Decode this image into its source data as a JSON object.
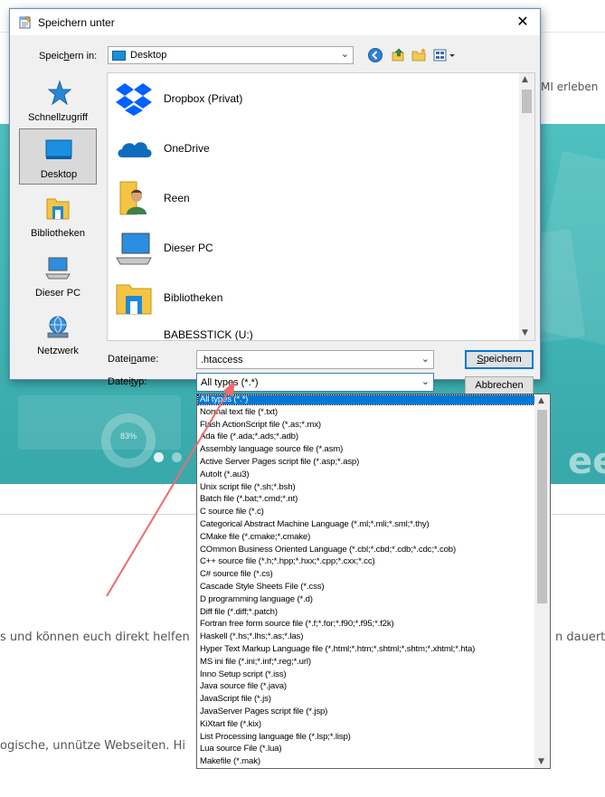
{
  "background_page": {
    "nav_text": "MI erleben",
    "body_text_1": "s und können euch direkt helfen",
    "body_text_2": "n dauert e",
    "body_text_3": "ogische, unnütze Webseiten. Hi",
    "banner_fragment": "ee",
    "banner_badge": "83%"
  },
  "dialog": {
    "title": "Speichern unter",
    "close_symbol": "✕",
    "save_in_label": {
      "pre": "Speic",
      "ul": "h",
      "post": "ern in:"
    },
    "location": "Desktop",
    "places": [
      {
        "label": "Schnellzugriff",
        "icon": "star-icon"
      },
      {
        "label": "Desktop",
        "icon": "desktop-icon",
        "selected": true
      },
      {
        "label": "Bibliotheken",
        "icon": "library-icon"
      },
      {
        "label": "Dieser PC",
        "icon": "computer-icon"
      },
      {
        "label": "Netzwerk",
        "icon": "network-icon"
      }
    ],
    "files": [
      {
        "name": "Dropbox (Privat)",
        "icon": "dropbox-icon"
      },
      {
        "name": "OneDrive",
        "icon": "onedrive-icon"
      },
      {
        "name": "Reen",
        "icon": "user-folder-icon"
      },
      {
        "name": "Dieser PC",
        "icon": "computer-icon"
      },
      {
        "name": "Bibliotheken",
        "icon": "library-icon"
      },
      {
        "name": "BABESSTICK (U:)",
        "icon": "usb-drive-icon"
      }
    ],
    "filename_label": {
      "pre": "Datei",
      "ul": "n",
      "post": "ame:"
    },
    "filename_value": ".htaccess",
    "filetype_label": {
      "pre": "Datei",
      "ul": "t",
      "post": "yp:"
    },
    "filetype_value": "All types (*.*)",
    "save_button": {
      "ul": "S",
      "post": "peichern"
    },
    "cancel_button": "Abbrechen",
    "accent_color": "#0078d7"
  },
  "filetype_options": [
    "All types (*.*)",
    "Normal text file (*.txt)",
    "Flash ActionScript file (*.as;*.mx)",
    "Ada file (*.ada;*.ads;*.adb)",
    "Assembly language source file (*.asm)",
    "Active Server Pages script file (*.asp;*.asp)",
    "AutoIt (*.au3)",
    "Unix script file (*.sh;*.bsh)",
    "Batch file (*.bat;*.cmd;*.nt)",
    "C source file (*.c)",
    "Categorical Abstract Machine Language (*.ml;*.mli;*.sml;*.thy)",
    "CMake file (*.cmake;*.cmake)",
    "COmmon Business Oriented Language (*.cbl;*.cbd;*.cdb;*.cdc;*.cob)",
    "C++ source file (*.h;*.hpp;*.hxx;*.cpp;*.cxx;*.cc)",
    "C# source file (*.cs)",
    "Cascade Style Sheets File (*.css)",
    "D programming language (*.d)",
    "Diff file (*.diff;*.patch)",
    "Fortran free form source file (*.f;*.for;*.f90;*.f95;*.f2k)",
    "Haskell (*.hs;*.lhs;*.as;*.las)",
    "Hyper Text Markup Language file (*.html;*.htm;*.shtml;*.shtm;*.xhtml;*.hta)",
    "MS ini file (*.ini;*.inf;*.reg;*.url)",
    "Inno Setup script (*.iss)",
    "Java source file (*.java)",
    "JavaScript file (*.js)",
    "JavaServer Pages script file (*.jsp)",
    "KiXtart file (*.kix)",
    "List Processing language file (*.lsp;*.lisp)",
    "Lua source File (*.lua)",
    "Makefile (*.mak)"
  ],
  "selected_filetype_index": 0
}
